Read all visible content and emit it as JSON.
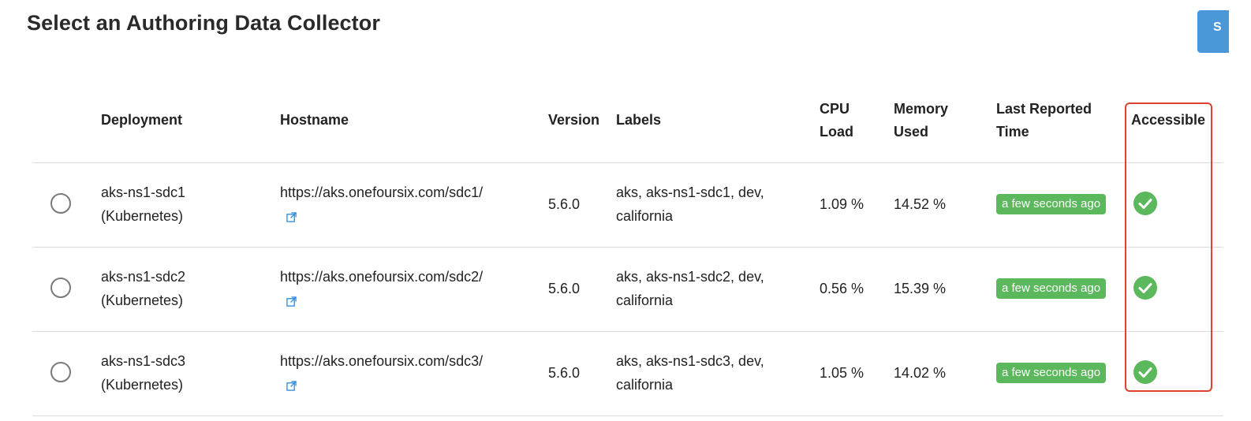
{
  "page": {
    "title": "Select an Authoring Data Collector",
    "top_button_label": "S"
  },
  "table": {
    "headers": {
      "deployment": "Deployment",
      "hostname": "Hostname",
      "version": "Version",
      "labels": "Labels",
      "cpu_load_1": "CPU",
      "cpu_load_2": "Load",
      "memory_used_1": "Memory",
      "memory_used_2": "Used",
      "last_reported_1": "Last Reported",
      "last_reported_2": "Time",
      "accessible": "Accessible"
    },
    "rows": [
      {
        "deployment_1": "aks-ns1-sdc1",
        "deployment_2": "(Kubernetes)",
        "hostname": "https://aks.onefoursix.com/sdc1/",
        "version": "5.6.0",
        "labels_1": "aks, aks-ns1-sdc1, dev,",
        "labels_2": "california",
        "cpu_load": "1.09 %",
        "memory_used": "14.52 %",
        "last_reported": "a few seconds ago",
        "accessible_icon": "check-circle-icon"
      },
      {
        "deployment_1": "aks-ns1-sdc2",
        "deployment_2": "(Kubernetes)",
        "hostname": "https://aks.onefoursix.com/sdc2/",
        "version": "5.6.0",
        "labels_1": "aks, aks-ns1-sdc2, dev,",
        "labels_2": "california",
        "cpu_load": "0.56 %",
        "memory_used": "15.39 %",
        "last_reported": "a few seconds ago",
        "accessible_icon": "check-circle-icon"
      },
      {
        "deployment_1": "aks-ns1-sdc3",
        "deployment_2": "(Kubernetes)",
        "hostname": "https://aks.onefoursix.com/sdc3/",
        "version": "5.6.0",
        "labels_1": "aks, aks-ns1-sdc3, dev,",
        "labels_2": "california",
        "cpu_load": "1.05 %",
        "memory_used": "14.02 %",
        "last_reported": "a few seconds ago",
        "accessible_icon": "check-circle-icon"
      }
    ]
  },
  "colors": {
    "badge_green": "#5cb85c",
    "check_green": "#5cb85c",
    "link_blue": "#2b8ad8",
    "highlight_red": "#e0412e",
    "button_blue": "#4a98d9"
  }
}
